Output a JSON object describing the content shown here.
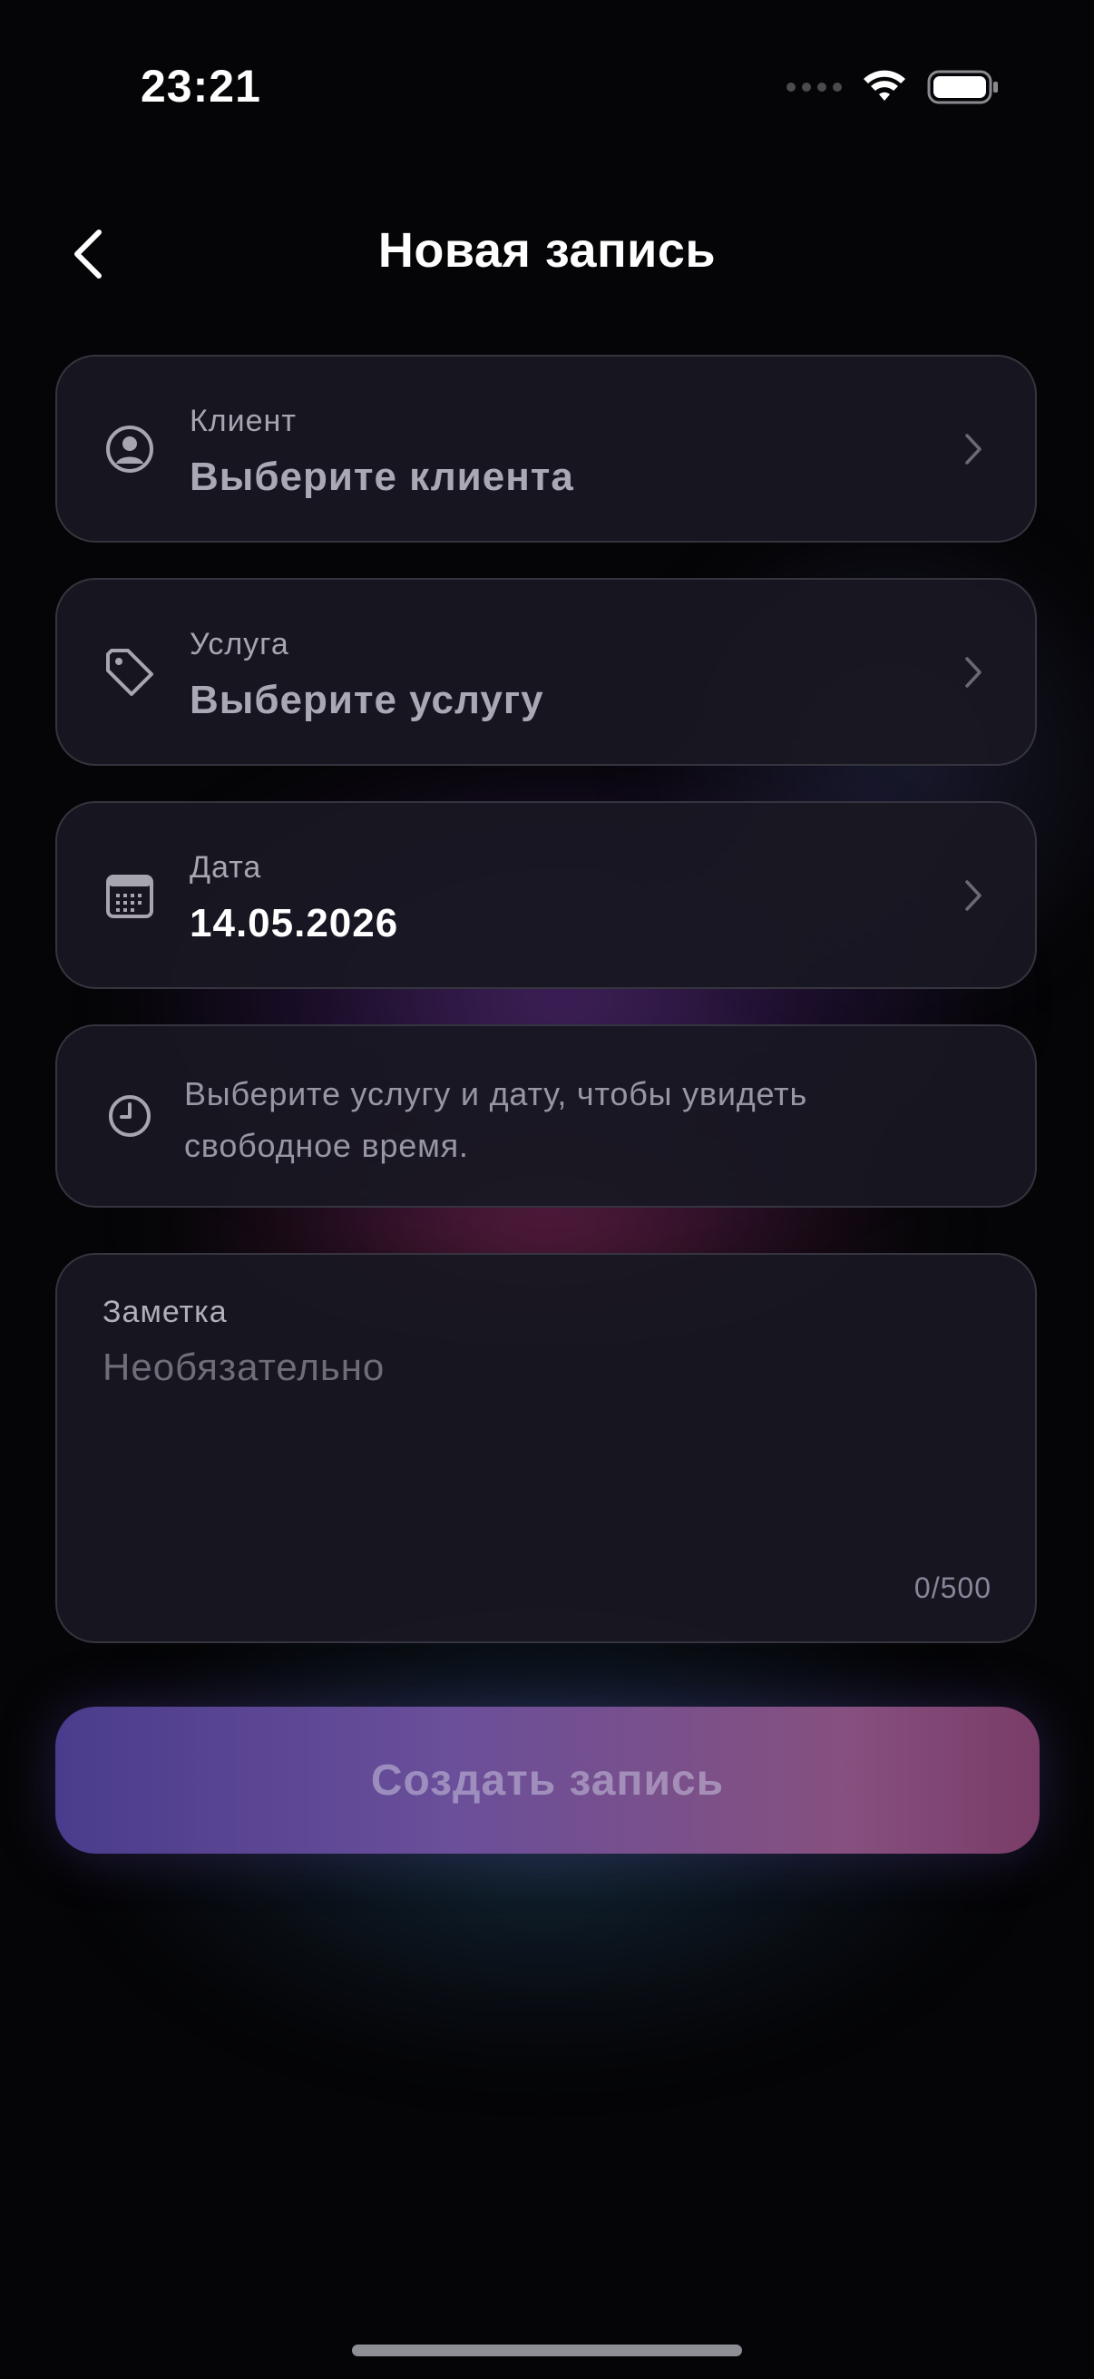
{
  "status_bar": {
    "time": "23:21",
    "signal_icon": "signal-dots-icon",
    "wifi_icon": "wifi-icon",
    "battery_icon": "battery-icon"
  },
  "header": {
    "back_icon": "chevron-left-icon",
    "title": "Новая запись"
  },
  "form": {
    "client": {
      "icon": "user-circle-icon",
      "label": "Клиент",
      "value": "Выберите клиента"
    },
    "service": {
      "icon": "tag-icon",
      "label": "Услуга",
      "value": "Выберите услугу"
    },
    "date": {
      "icon": "calendar-icon",
      "label": "Дата",
      "value": "14.05.2026"
    },
    "time_info": {
      "icon": "clock-icon",
      "text": "Выберите услугу и дату, чтобы увидеть свободное время."
    },
    "note": {
      "label": "Заметка",
      "placeholder": "Необязательно",
      "value": "",
      "counter": "0/500"
    }
  },
  "actions": {
    "submit_label": "Создать запись"
  },
  "colors": {
    "background": "#050507",
    "card": "#181722",
    "card_border": "#35343f",
    "button_gradient_start": "#4a3c8c",
    "button_gradient_end": "#7a3c68"
  }
}
